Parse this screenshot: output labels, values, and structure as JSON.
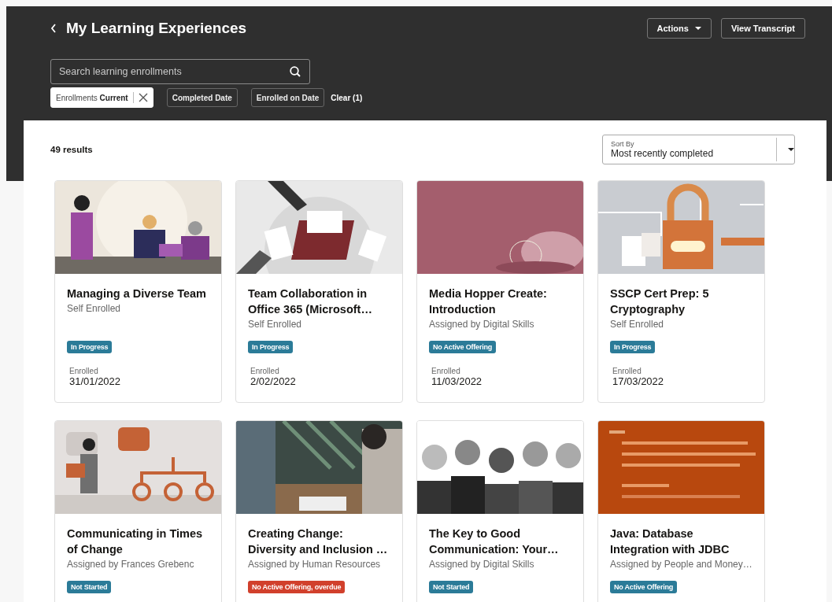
{
  "header": {
    "title": "My Learning Experiences",
    "buttons": [
      {
        "label": "Actions",
        "kind": "menu"
      },
      {
        "label": "View Transcript",
        "kind": "plain"
      }
    ],
    "search": {
      "placeholder": "Search learning enrollments"
    },
    "filters": [
      {
        "kind": "applied",
        "label": "Enrollments",
        "value": "Current"
      },
      {
        "kind": "option",
        "label": "Completed Date"
      },
      {
        "kind": "option",
        "label": "Enrolled on Date"
      }
    ],
    "clear_link": "Clear (1)"
  },
  "results": {
    "count": "49 results",
    "sort": {
      "label": "Sort By",
      "value": "Most recently completed"
    }
  },
  "cards": [
    {
      "title": "Managing a Diverse Team",
      "assignment": "Self Enrolled",
      "status": {
        "label": "In Progress",
        "color": "#2b7b98"
      },
      "enrolled_label": "Enrolled",
      "enrolled_date": "31/01/2022"
    },
    {
      "title": "Team Collaboration in Office 365 (Microsoft…",
      "assignment": "Self Enrolled",
      "status": {
        "label": "In Progress",
        "color": "#2b7b98"
      },
      "enrolled_label": "Enrolled",
      "enrolled_date": "2/02/2022"
    },
    {
      "title": "Media Hopper Create: Introduction",
      "assignment": "Assigned by Digital Skills",
      "status": {
        "label": "No Active Offering",
        "color": "#2b7b98"
      },
      "enrolled_label": "Enrolled",
      "enrolled_date": "11/03/2022"
    },
    {
      "title": "SSCP Cert Prep: 5 Cryptography",
      "assignment": "Self Enrolled",
      "status": {
        "label": "In Progress",
        "color": "#2b7b98"
      },
      "enrolled_label": "Enrolled",
      "enrolled_date": "17/03/2022"
    },
    {
      "title": "Communicating in Times of Change",
      "assignment": "Assigned by Frances Grebenc",
      "status": {
        "label": "Not Started",
        "color": "#2b7b98"
      }
    },
    {
      "title": "Creating Change: Diversity and Inclusion …",
      "assignment": "Assigned by Human Resources",
      "status": {
        "label": "No Active Offering, overdue",
        "color": "#d1402c"
      }
    },
    {
      "title": "The Key to Good Communication: Your…",
      "assignment": "Assigned by Digital Skills",
      "status": {
        "label": "Not Started",
        "color": "#2b7b98"
      }
    },
    {
      "title": "Java: Database Integration with JDBC",
      "assignment": "Assigned by People and Money…",
      "status": {
        "label": "No Active Offering",
        "color": "#2b7b98"
      }
    }
  ]
}
